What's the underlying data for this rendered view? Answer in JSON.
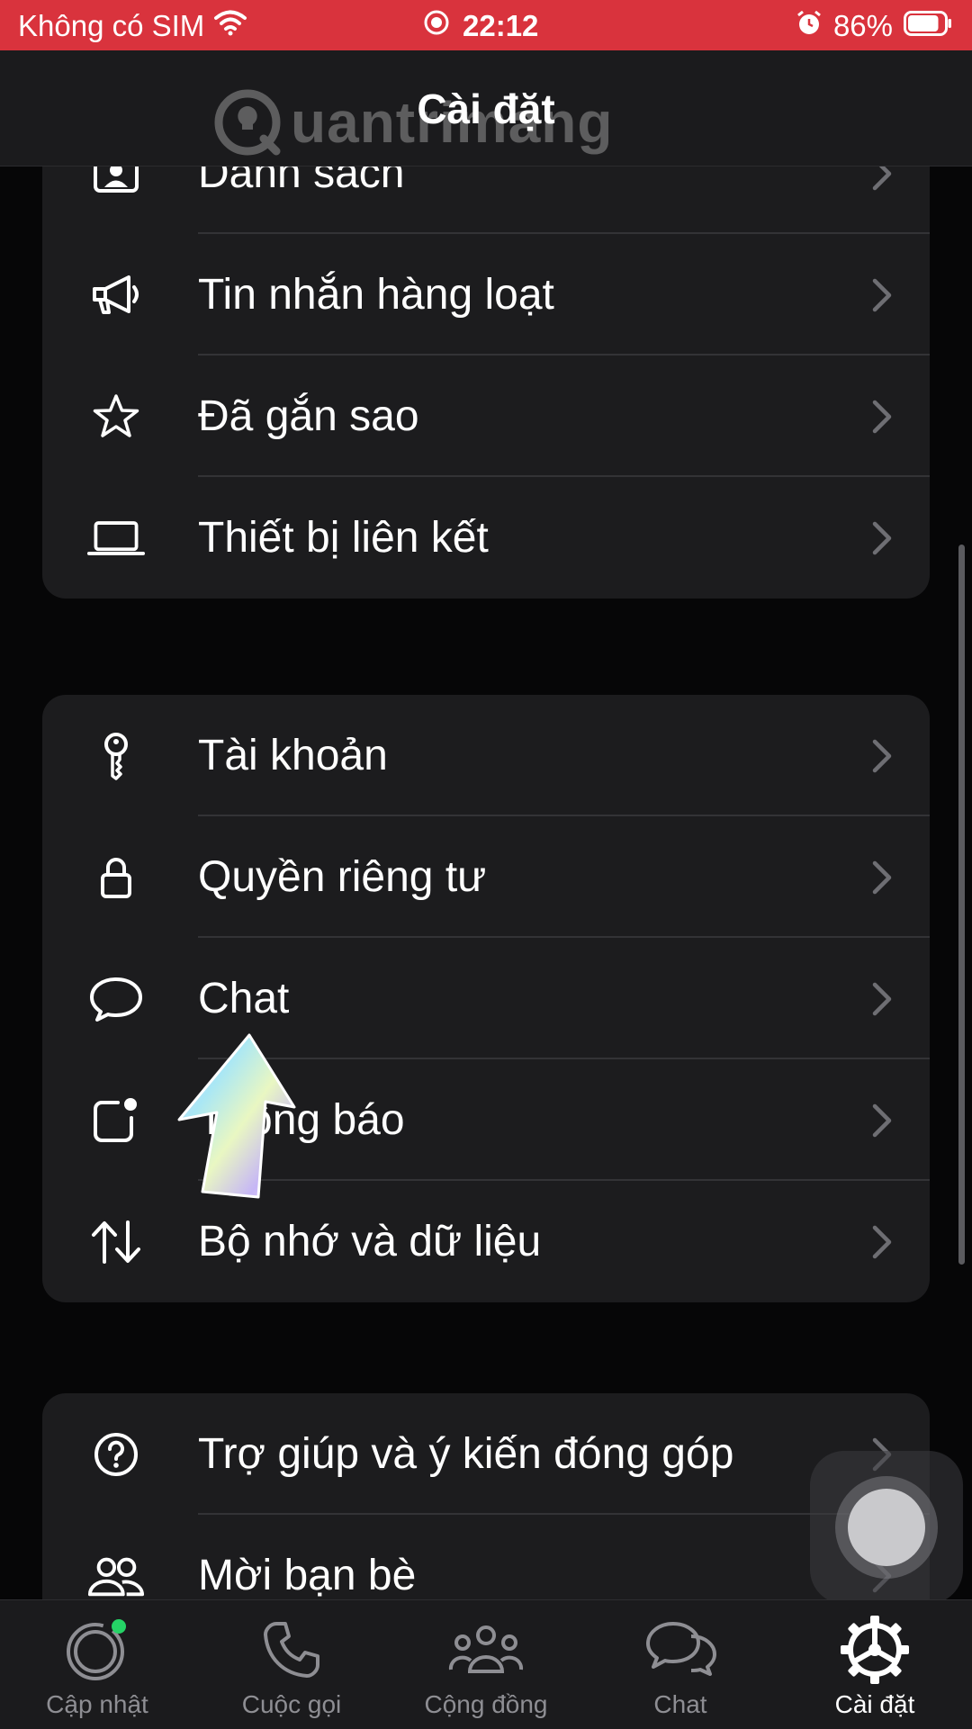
{
  "status_bar": {
    "carrier": "Không có SIM",
    "time": "22:12",
    "battery": "86%",
    "battery_level": 0.86
  },
  "nav": {
    "title": "Cài đặt",
    "watermark": "uantrimang"
  },
  "groups": [
    {
      "items": [
        {
          "label": "Danh sách",
          "icon": "contact-card-icon"
        },
        {
          "label": "Tin nhắn hàng loạt",
          "icon": "megaphone-icon"
        },
        {
          "label": "Đã gắn sao",
          "icon": "star-icon"
        },
        {
          "label": "Thiết bị liên kết",
          "icon": "laptop-icon"
        }
      ]
    },
    {
      "items": [
        {
          "label": "Tài khoản",
          "icon": "key-icon"
        },
        {
          "label": "Quyền riêng tư",
          "icon": "lock-icon"
        },
        {
          "label": "Chat",
          "icon": "chat-bubble-icon"
        },
        {
          "label": "Thông báo",
          "icon": "notification-icon"
        },
        {
          "label": "Bộ nhớ và dữ liệu",
          "icon": "arrows-up-down-icon"
        }
      ]
    },
    {
      "items": [
        {
          "label": "Trợ giúp và ý kiến đóng góp",
          "icon": "help-icon"
        },
        {
          "label": "Mời bạn bè",
          "icon": "people-icon"
        }
      ]
    }
  ],
  "tabs": [
    {
      "label": "Cập nhật",
      "icon": "updates-icon"
    },
    {
      "label": "Cuộc gọi",
      "icon": "phone-icon"
    },
    {
      "label": "Cộng đồng",
      "icon": "community-icon"
    },
    {
      "label": "Chat",
      "icon": "chats-icon"
    },
    {
      "label": "Cài đặt",
      "icon": "settings-gear-icon",
      "active": true
    }
  ],
  "colors": {
    "status_bar": "#d9333d",
    "accent_dot": "#25d366",
    "group_bg": "#1c1c1e"
  }
}
